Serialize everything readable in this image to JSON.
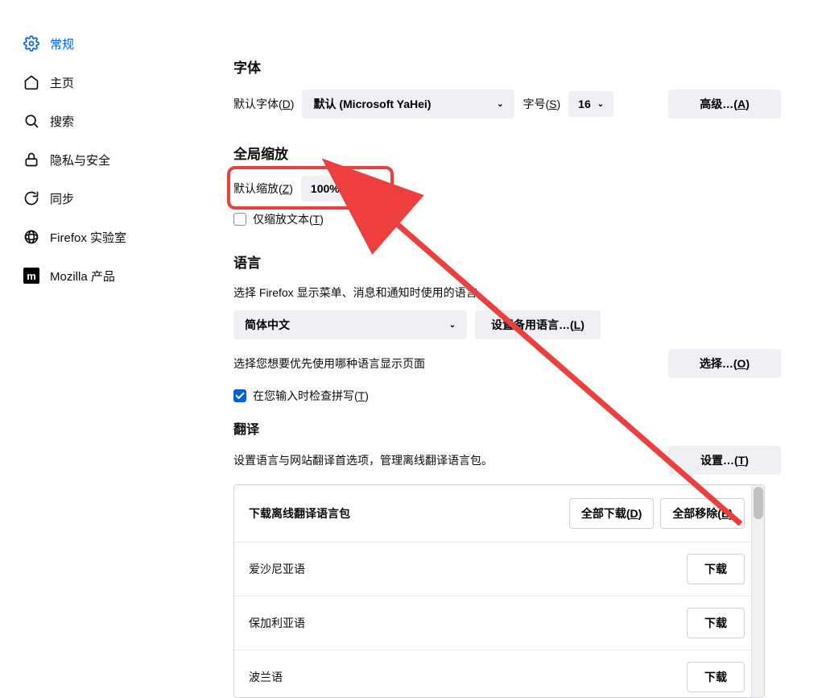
{
  "sidebar": {
    "items": [
      {
        "label": "常规"
      },
      {
        "label": "主页"
      },
      {
        "label": "搜索"
      },
      {
        "label": "隐私与安全"
      },
      {
        "label": "同步"
      },
      {
        "label": "Firefox 实验室"
      },
      {
        "label": "Mozilla 产品"
      }
    ]
  },
  "fonts": {
    "heading": "字体",
    "default_font_label_pre": "默认字体(",
    "default_font_label_key": "D",
    "default_font_label_post": ")",
    "font_value": "默认  (Microsoft YaHei)",
    "size_label_pre": "字号(",
    "size_label_key": "S",
    "size_label_post": ")",
    "size_value": "16",
    "advanced_pre": "高级…(",
    "advanced_key": "A",
    "advanced_post": ")"
  },
  "zoom": {
    "heading": "全局缩放",
    "default_zoom_label_pre": "默认缩放(",
    "default_zoom_label_key": "Z",
    "default_zoom_label_post": ")",
    "zoom_value": "100%",
    "text_only_pre": "仅缩放文本(",
    "text_only_key": "T",
    "text_only_post": ")"
  },
  "language": {
    "heading": "语言",
    "desc": "选择 Firefox 显示菜单、消息和通知时使用的语言。",
    "current": "简体中文",
    "alt_button_pre": "设置备用语言…(",
    "alt_button_key": "L",
    "alt_button_post": ")",
    "page_lang_desc": "选择您想要优先使用哪种语言显示页面",
    "choose_pre": "选择…(",
    "choose_key": "O",
    "choose_post": ")",
    "spellcheck_pre": "在您输入时检查拼写(",
    "spellcheck_key": "T",
    "spellcheck_post": ")"
  },
  "translation": {
    "heading": "翻译",
    "desc": "设置语言与网站翻译首选项，管理离线翻译语言包。",
    "settings_pre": "设置…(",
    "settings_key": "T",
    "settings_post": ")",
    "download_title": "下载离线翻译语言包",
    "download_all_pre": "全部下载(",
    "download_all_key": "D",
    "download_all_post": ")",
    "remove_all_pre": "全部移除(",
    "remove_all_key": "E",
    "remove_all_post": ")",
    "download_btn": "下载",
    "languages": [
      "爱沙尼亚语",
      "保加利亚语",
      "波兰语"
    ]
  }
}
